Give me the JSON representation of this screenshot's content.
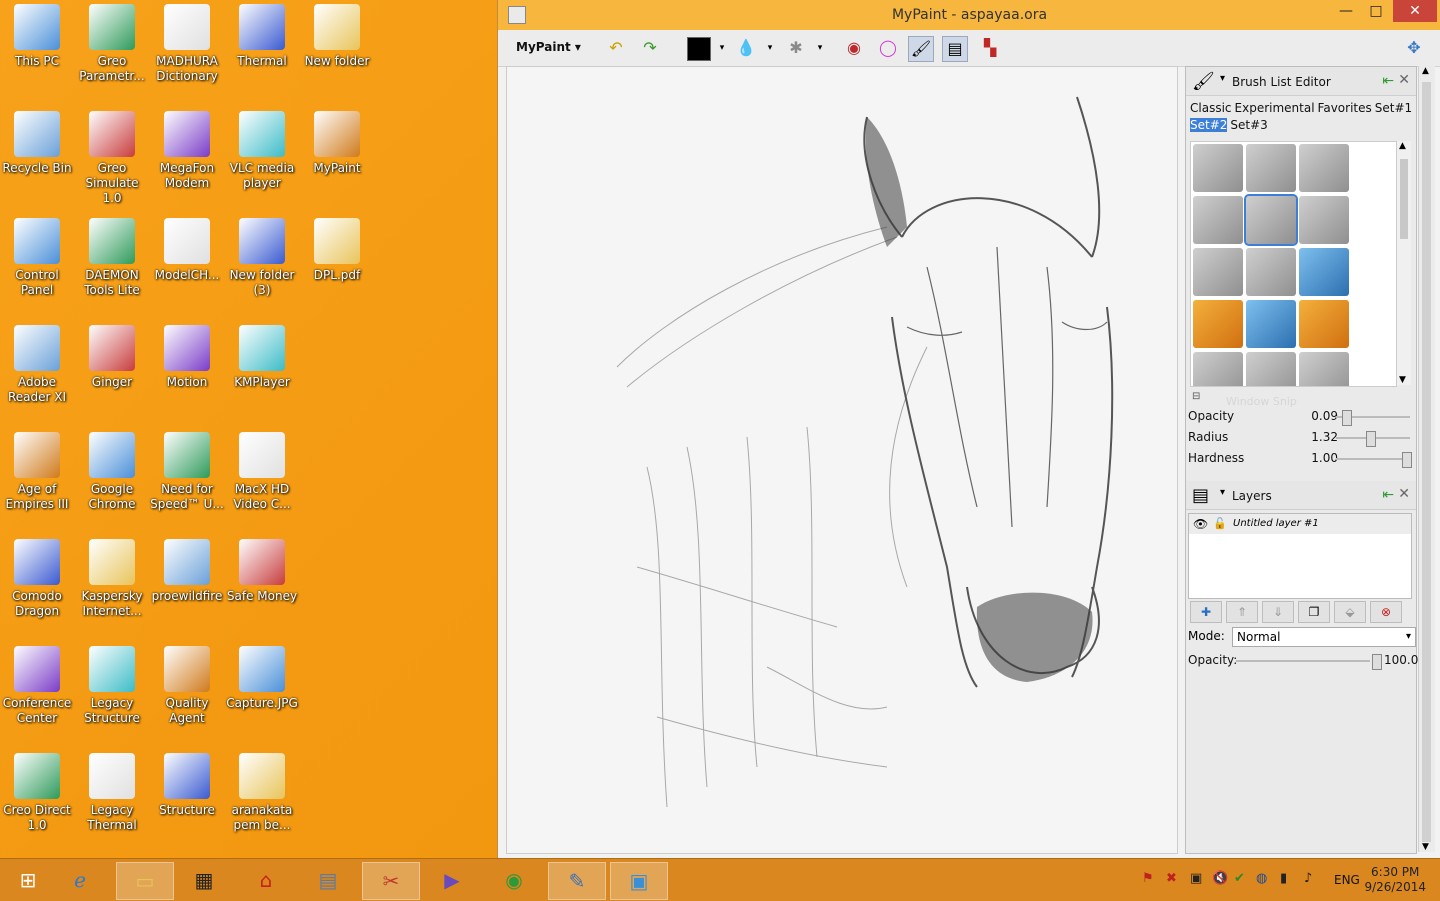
{
  "desktop_icons": [
    {
      "label": "This PC",
      "icon": "computer-icon",
      "col": 0,
      "row": 0
    },
    {
      "label": "Greo\nParametr...",
      "icon": "greo-parametric-icon",
      "col": 1,
      "row": 0
    },
    {
      "label": "MADHURA\nDictionary",
      "icon": "dictionary-icon",
      "col": 2,
      "row": 0
    },
    {
      "label": "Thermal",
      "icon": "thermal-icon",
      "col": 3,
      "row": 0
    },
    {
      "label": "New folder",
      "icon": "folder-icon",
      "col": 4,
      "row": 0
    },
    {
      "label": "Recycle Bin",
      "icon": "recycle-bin-icon",
      "col": 0,
      "row": 1
    },
    {
      "label": "Greo\nSimulate 1.0",
      "icon": "greo-simulate-icon",
      "col": 1,
      "row": 1
    },
    {
      "label": "MegaFon\nModem",
      "icon": "modem-icon",
      "col": 2,
      "row": 1
    },
    {
      "label": "VLC media\nplayer",
      "icon": "vlc-icon",
      "col": 3,
      "row": 1
    },
    {
      "label": "MyPaint",
      "icon": "mypaint-icon",
      "col": 4,
      "row": 1
    },
    {
      "label": "Control\nPanel",
      "icon": "control-panel-icon",
      "col": 0,
      "row": 2
    },
    {
      "label": "DAEMON\nTools Lite",
      "icon": "daemon-tools-icon",
      "col": 1,
      "row": 2
    },
    {
      "label": "ModelCH...",
      "icon": "modelch-icon",
      "col": 2,
      "row": 2
    },
    {
      "label": "New folder\n(3)",
      "icon": "folder-icon",
      "col": 3,
      "row": 2
    },
    {
      "label": "DPL.pdf",
      "icon": "pdf-icon",
      "col": 4,
      "row": 2
    },
    {
      "label": "Adobe\nReader XI",
      "icon": "adobe-reader-icon",
      "col": 0,
      "row": 3
    },
    {
      "label": "Ginger",
      "icon": "ginger-icon",
      "col": 1,
      "row": 3
    },
    {
      "label": "Motion",
      "icon": "motion-icon",
      "col": 2,
      "row": 3
    },
    {
      "label": "KMPlayer",
      "icon": "kmplayer-icon",
      "col": 3,
      "row": 3
    },
    {
      "label": "Age of\nEmpires III",
      "icon": "age-of-empires-icon",
      "col": 0,
      "row": 4
    },
    {
      "label": "Google\nChrome",
      "icon": "chrome-icon",
      "col": 1,
      "row": 4
    },
    {
      "label": "Need for\nSpeed™ U...",
      "icon": "need-for-speed-icon",
      "col": 2,
      "row": 4
    },
    {
      "label": "MacX HD\nVideo C...",
      "icon": "video-converter-icon",
      "col": 3,
      "row": 4
    },
    {
      "label": "Comodo\nDragon",
      "icon": "comodo-dragon-icon",
      "col": 0,
      "row": 5
    },
    {
      "label": "Kaspersky\nInternet...",
      "icon": "kaspersky-icon",
      "col": 1,
      "row": 5
    },
    {
      "label": "proewildfire",
      "icon": "proewildfire-icon",
      "col": 2,
      "row": 5
    },
    {
      "label": "Safe Money",
      "icon": "safe-money-icon",
      "col": 3,
      "row": 5
    },
    {
      "label": "Conference\nCenter",
      "icon": "conference-center-icon",
      "col": 0,
      "row": 6
    },
    {
      "label": "Legacy\nStructure",
      "icon": "legacy-structure-icon",
      "col": 1,
      "row": 6
    },
    {
      "label": "Quality\nAgent",
      "icon": "quality-agent-icon",
      "col": 2,
      "row": 6
    },
    {
      "label": "Capture.JPG",
      "icon": "image-file-icon",
      "col": 3,
      "row": 6
    },
    {
      "label": "Creo Direct\n1.0",
      "icon": "creo-direct-icon",
      "col": 0,
      "row": 7
    },
    {
      "label": "Legacy\nThermal",
      "icon": "legacy-thermal-icon",
      "col": 1,
      "row": 7
    },
    {
      "label": "Structure",
      "icon": "structure-icon",
      "col": 2,
      "row": 7
    },
    {
      "label": "aranakata\npem be...",
      "icon": "pdf-icon",
      "col": 3,
      "row": 7
    }
  ],
  "window": {
    "title": "MyPaint - aspayaa.ora",
    "minimize": "—",
    "maximize": "□",
    "close": "✕"
  },
  "toolbar": {
    "menu_label": "MyPaint ▾",
    "undo": "↶",
    "redo": "↷",
    "color_swatch": "#000000"
  },
  "brush_panel": {
    "title": "Brush List Editor",
    "groups": [
      "Classic",
      "Experimental",
      "Favorites",
      "Set#1",
      "Set#2",
      "Set#3"
    ],
    "selected_group": "Set#2",
    "window_snip": "Window Snip"
  },
  "brush_settings": [
    {
      "name": "Opacity",
      "value": "0.09",
      "level": 0.09
    },
    {
      "name": "Radius",
      "value": "1.32",
      "level": 0.45
    },
    {
      "name": "Hardness",
      "value": "1.00",
      "level": 1.0
    }
  ],
  "layers_panel": {
    "title": "Layers",
    "layers": [
      {
        "name": "Untitled layer #1"
      }
    ],
    "mode_label": "Mode:",
    "mode_value": "Normal",
    "opacity_label": "Opacity:",
    "opacity_value": "100.0"
  },
  "taskbar": {
    "language": "ENG",
    "time": "6:30 PM",
    "date": "9/26/2014"
  }
}
